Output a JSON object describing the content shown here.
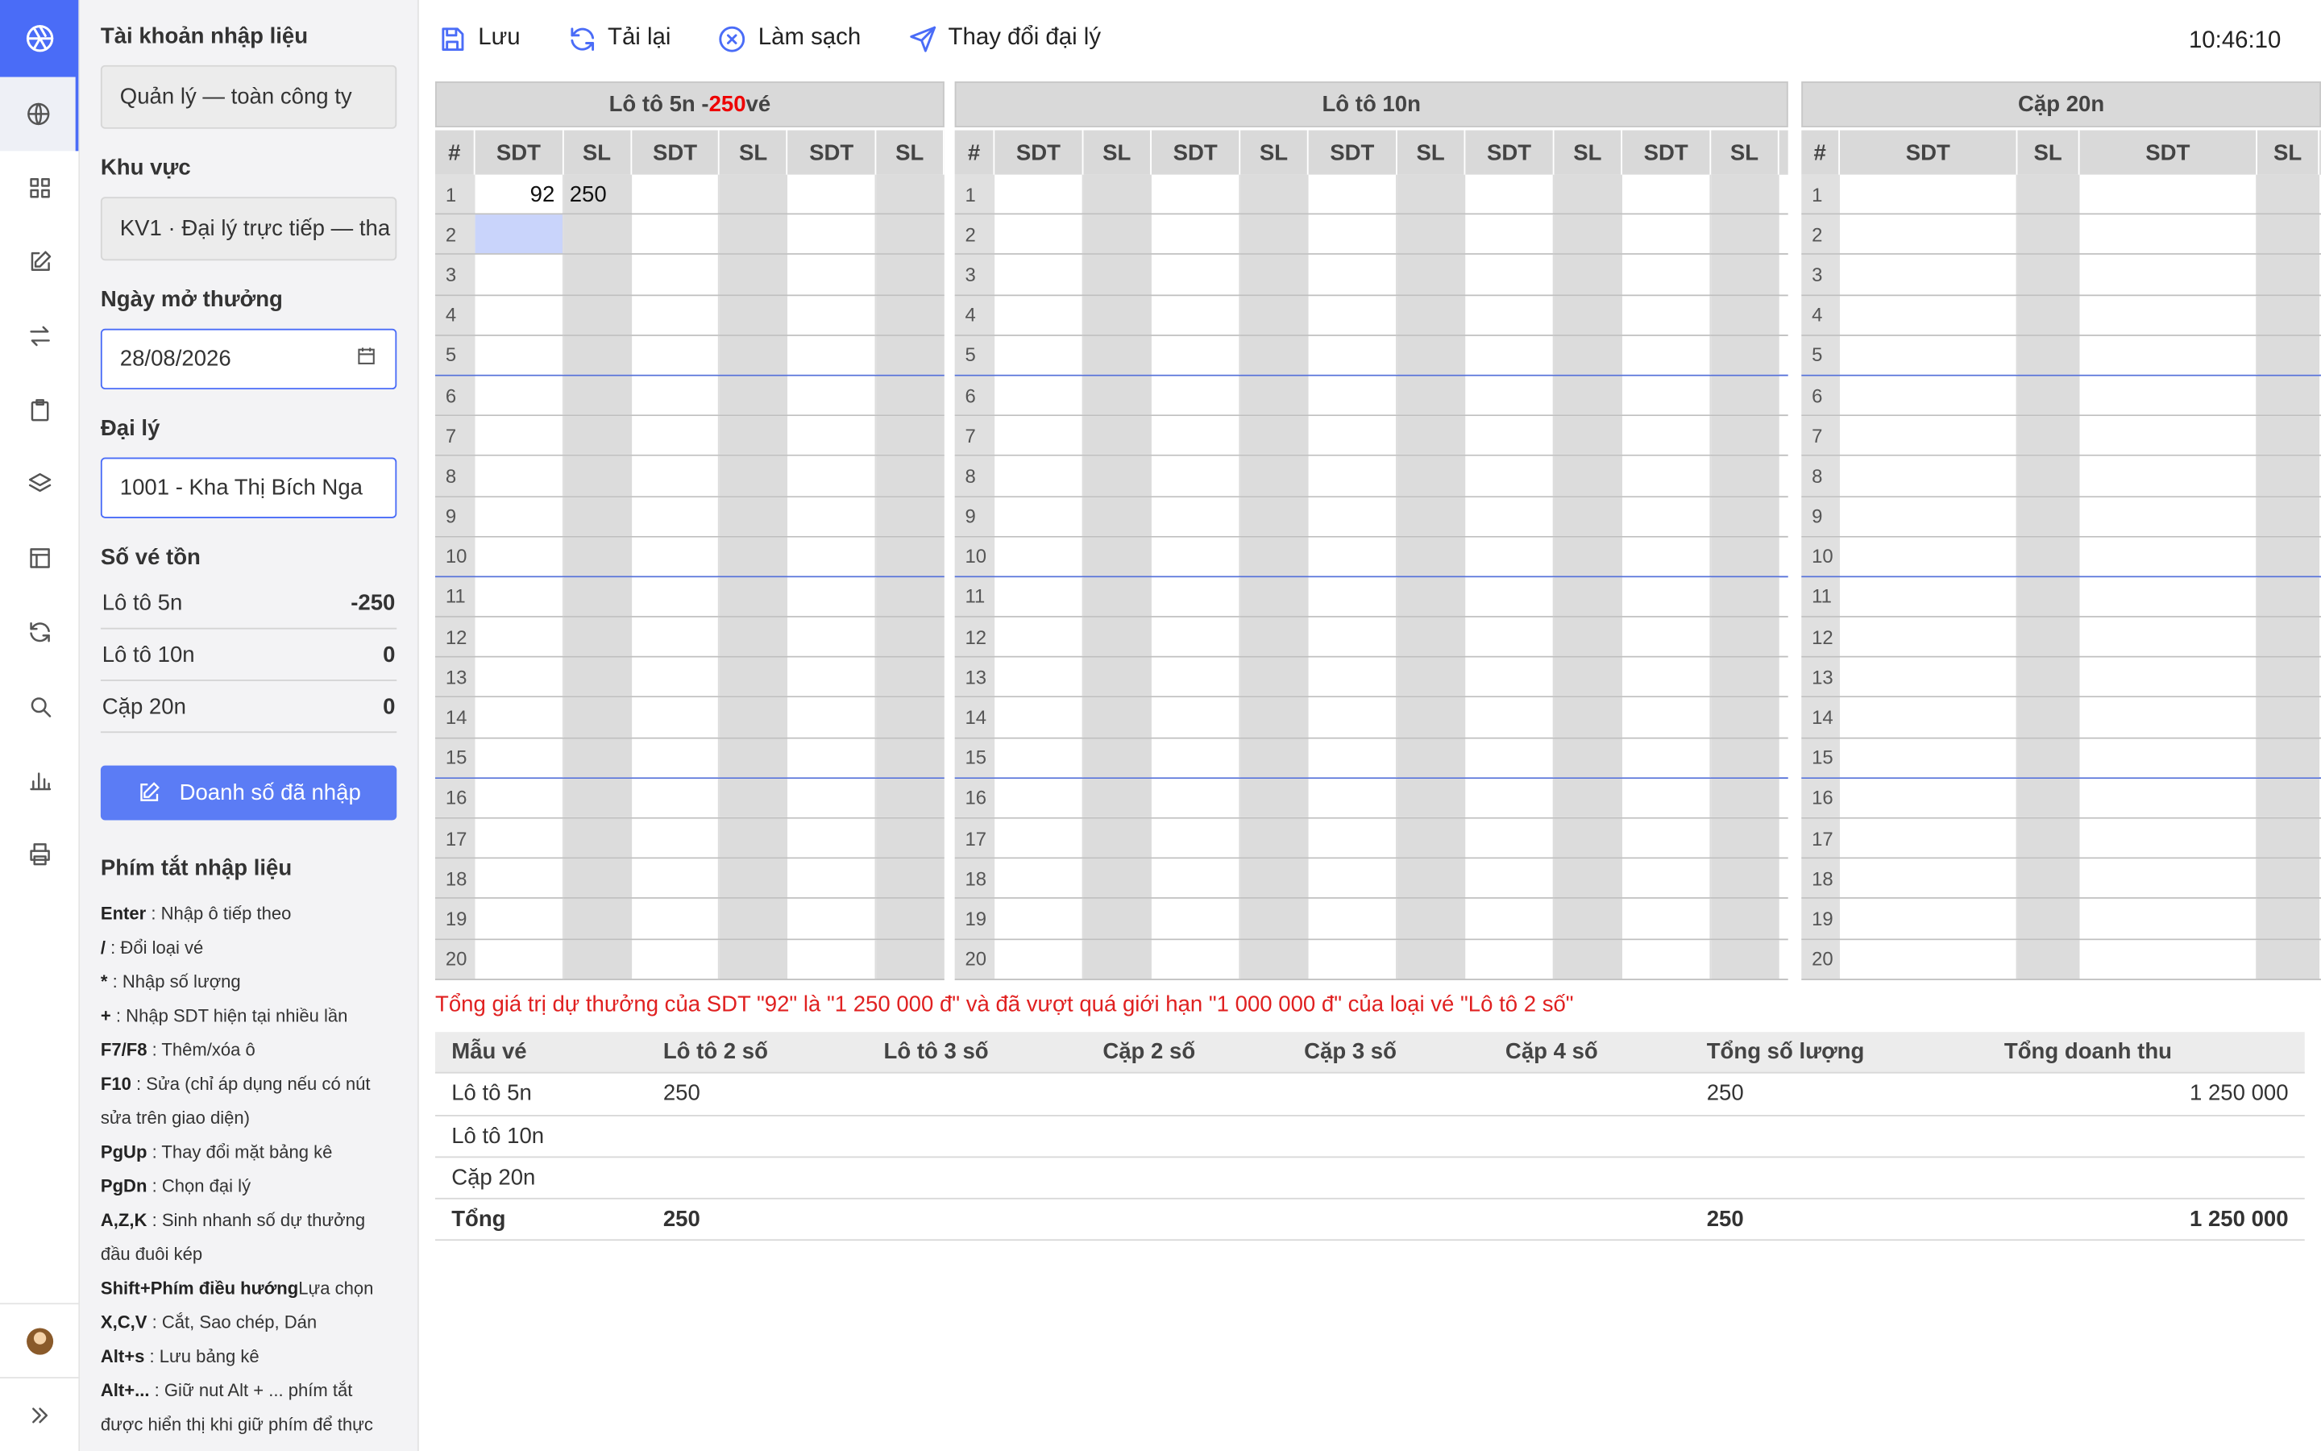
{
  "nav": {
    "items": [
      "globe",
      "grid",
      "edit",
      "swap",
      "clipboard",
      "layers",
      "table",
      "refresh",
      "search",
      "chart",
      "print"
    ],
    "bottom": [
      "avatar",
      "expand"
    ]
  },
  "panel": {
    "account_label": "Tài khoản nhập liệu",
    "account_value": "Quản lý — toàn công ty",
    "region_label": "Khu vực",
    "region_value": "KV1 · Đại lý trực tiếp — tha",
    "date_label": "Ngày mở thưởng",
    "date_value": "28/08/2026",
    "agent_label": "Đại lý",
    "agent_value": "1001 - Kha Thị Bích Nga",
    "stock_label": "Số vé tồn",
    "stock": [
      {
        "name": "Lô tô 5n",
        "value": "-250"
      },
      {
        "name": "Lô tô 10n",
        "value": "0"
      },
      {
        "name": "Cặp 20n",
        "value": "0"
      }
    ],
    "sales_button": "Doanh số đã nhập",
    "shortcuts_label": "Phím tắt nhập liệu",
    "shortcuts": [
      {
        "key": "Enter",
        "desc": " : Nhập ô tiếp theo"
      },
      {
        "key": "/",
        "desc": " : Đổi loại vé"
      },
      {
        "key": "*",
        "desc": " : Nhập số lượng"
      },
      {
        "key": "+",
        "desc": " : Nhập SDT hiện tại nhiều lần"
      },
      {
        "key": "F7/F8",
        "desc": " : Thêm/xóa ô"
      },
      {
        "key": "F10",
        "desc": " : Sửa (chỉ áp dụng nếu có nút sửa trên giao diện)"
      },
      {
        "key": "PgUp",
        "desc": " : Thay đổi mặt bảng kê"
      },
      {
        "key": "PgDn",
        "desc": " : Chọn đại lý"
      },
      {
        "key": "A,Z,K",
        "desc": " : Sinh nhanh số dự thưởng đầu đuôi kép"
      },
      {
        "key": "Shift+Phím điều hướng",
        "desc": "Lựa chọn"
      },
      {
        "key": "X,C,V",
        "desc": " : Cắt, Sao chép, Dán"
      },
      {
        "key": "Alt+s",
        "desc": " : Lưu bảng kê"
      },
      {
        "key": "Alt+...",
        "desc": " : Giữ nut Alt + ... phím tắt được hiển thị khi giữ phím để thực hiện"
      }
    ]
  },
  "toolbar": {
    "save": "Lưu",
    "reload": "Tải lại",
    "clear": "Làm sạch",
    "change_agent": "Thay đổi đại lý",
    "clock": "10:46:10"
  },
  "grids": [
    {
      "title_prefix": "Lô tô 5n - ",
      "title_highlight": "250",
      "title_suffix": " vé",
      "pairs": 3
    },
    {
      "title_prefix": "Lô tô 10n",
      "title_highlight": "",
      "title_suffix": "",
      "pairs": 5
    },
    {
      "title_prefix": "Cặp 20n",
      "title_highlight": "",
      "title_suffix": "",
      "pairs": 2
    }
  ],
  "col_headers": {
    "num": "#",
    "sdt": "SDT",
    "sl": "SL"
  },
  "entries": {
    "sdt": "92",
    "sl": "250"
  },
  "warning": "Tổng giá trị dự thưởng của SDT \"92\" là \"1 250 000 đ\" và đã vượt quá giới hạn \"1 000 000 đ\" của loại vé \"Lô tô 2 số\"",
  "summary": {
    "headers": [
      "Mẫu vé",
      "Lô tô 2 số",
      "Lô tô 3 số",
      "Cặp 2 số",
      "Cặp 3 số",
      "Cặp 4 số",
      "Tổng số lượng",
      "Tổng doanh thu"
    ],
    "rows": [
      [
        "Lô tô 5n",
        "250",
        "",
        "",
        "",
        "",
        "250",
        "1 250 000"
      ],
      [
        "Lô tô 10n",
        "",
        "",
        "",
        "",
        "",
        "",
        ""
      ],
      [
        "Cặp 20n",
        "",
        "",
        "",
        "",
        "",
        "",
        ""
      ],
      [
        "Tổng",
        "250",
        "",
        "",
        "",
        "",
        "250",
        "1 250 000"
      ]
    ]
  }
}
